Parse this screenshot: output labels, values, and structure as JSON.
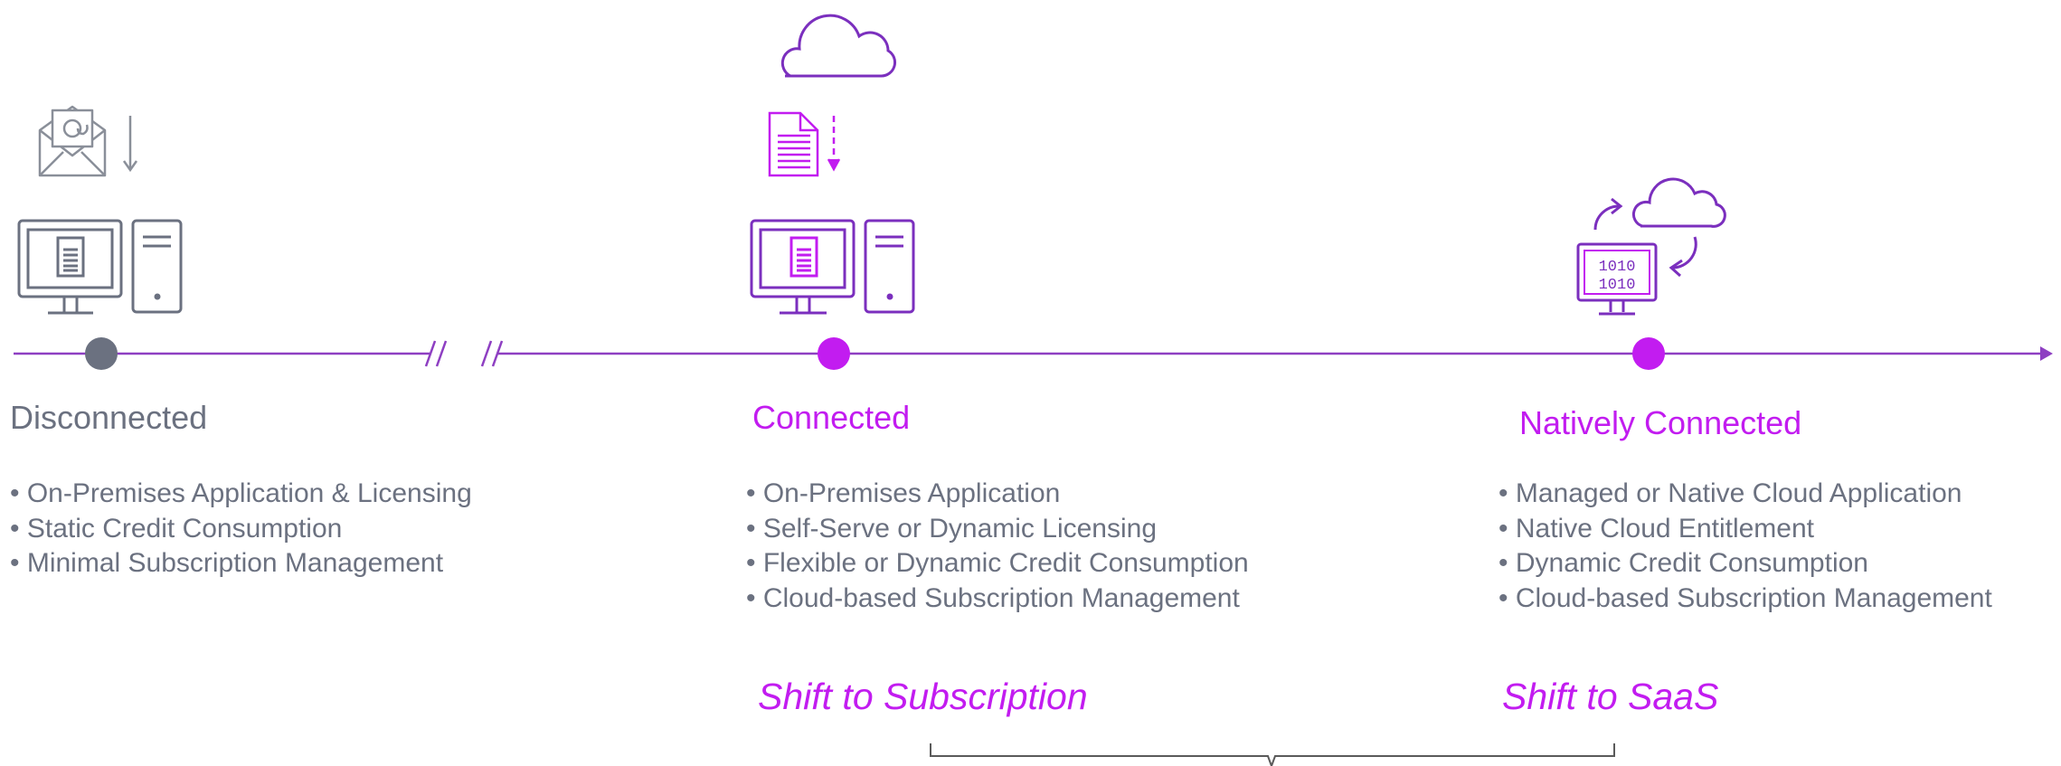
{
  "colors": {
    "gray": "#6b7180",
    "gray_icon": "#8a8f99",
    "purple_dark": "#7b2fbe",
    "magenta": "#c21cf0",
    "timeline": "#8e3fc2",
    "bracket": "#5a5a5a"
  },
  "stages": [
    {
      "title": "Disconnected",
      "icons": [
        "email-envelope-icon",
        "download-arrow-icon",
        "desktop-computer-icon",
        "tower-icon"
      ],
      "bullets": [
        "On-Premises Application & Licensing",
        "Static Credit Consumption",
        "Minimal Subscription Management"
      ]
    },
    {
      "title": "Connected",
      "icons": [
        "cloud-icon",
        "document-icon",
        "dashed-download-arrow-icon",
        "desktop-computer-icon",
        "tower-icon"
      ],
      "bullets": [
        "On-Premises Application",
        "Self-Serve or Dynamic Licensing",
        "Flexible or Dynamic Credit Consumption",
        "Cloud-based Subscription Management"
      ]
    },
    {
      "title": "Natively Connected",
      "icons": [
        "cloud-icon",
        "sync-arrows-icon",
        "binary-monitor-icon"
      ],
      "bullets": [
        "Managed or Native Cloud Application",
        "Native Cloud Entitlement",
        "Dynamic Credit Consumption",
        "Cloud-based Subscription Management"
      ]
    }
  ],
  "shifts": [
    {
      "label": "Shift to Subscription"
    },
    {
      "label": "Shift to SaaS"
    }
  ]
}
